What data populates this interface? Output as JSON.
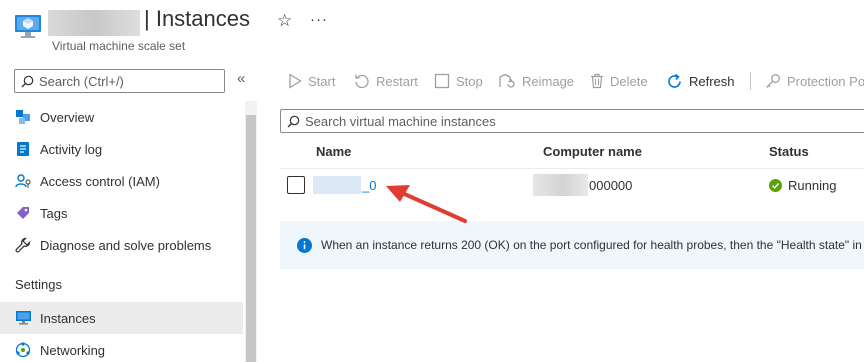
{
  "header": {
    "title": "| Instances",
    "subtitle": "Virtual machine scale set",
    "favorite_icon": "star-icon",
    "more_label": "···"
  },
  "sidebar": {
    "search_placeholder": "Search (Ctrl+/)",
    "collapse_label": "«",
    "items": [
      {
        "label": "Overview",
        "icon": "overview-icon"
      },
      {
        "label": "Activity log",
        "icon": "activity-log-icon"
      },
      {
        "label": "Access control (IAM)",
        "icon": "iam-icon"
      },
      {
        "label": "Tags",
        "icon": "tag-icon"
      },
      {
        "label": "Diagnose and solve problems",
        "icon": "wrench-icon"
      }
    ],
    "settings_header": "Settings",
    "settings_items": [
      {
        "label": "Instances",
        "icon": "vm-icon",
        "active": true
      },
      {
        "label": "Networking",
        "icon": "network-icon"
      }
    ]
  },
  "toolbar": {
    "start": "Start",
    "restart": "Restart",
    "stop": "Stop",
    "reimage": "Reimage",
    "delete": "Delete",
    "refresh": "Refresh",
    "protection": "Protection Po"
  },
  "main": {
    "search_placeholder": "Search virtual machine instances",
    "columns": [
      "Name",
      "Computer name",
      "Status"
    ],
    "rows": [
      {
        "name_suffix": "_0",
        "computer_suffix": "000000",
        "status": "Running"
      }
    ],
    "info_text": "When an instance returns 200 (OK) on the port configured for health probes, then the \"Health state\" in"
  },
  "colors": {
    "accent": "#0078d4",
    "running": "#57a300",
    "info_bg": "#eff6fc",
    "annotation_arrow": "#e03c31"
  }
}
